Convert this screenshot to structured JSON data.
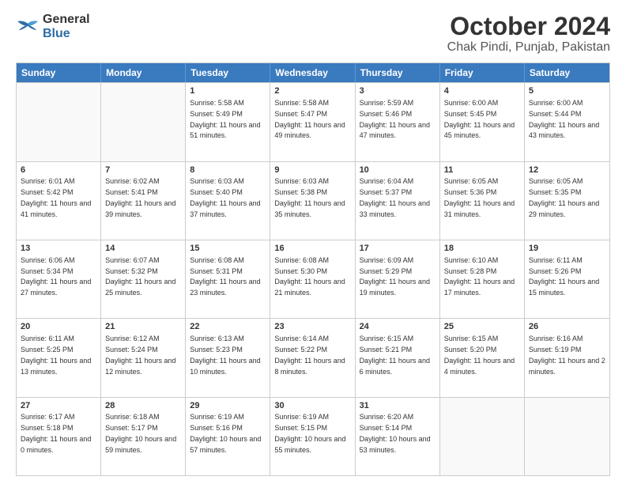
{
  "header": {
    "logo_general": "General",
    "logo_blue": "Blue",
    "title": "October 2024",
    "subtitle": "Chak Pindi, Punjab, Pakistan"
  },
  "calendar": {
    "days": [
      "Sunday",
      "Monday",
      "Tuesday",
      "Wednesday",
      "Thursday",
      "Friday",
      "Saturday"
    ],
    "rows": [
      [
        {
          "day": "",
          "content": ""
        },
        {
          "day": "",
          "content": ""
        },
        {
          "day": "1",
          "content": "Sunrise: 5:58 AM\nSunset: 5:49 PM\nDaylight: 11 hours and 51 minutes."
        },
        {
          "day": "2",
          "content": "Sunrise: 5:58 AM\nSunset: 5:47 PM\nDaylight: 11 hours and 49 minutes."
        },
        {
          "day": "3",
          "content": "Sunrise: 5:59 AM\nSunset: 5:46 PM\nDaylight: 11 hours and 47 minutes."
        },
        {
          "day": "4",
          "content": "Sunrise: 6:00 AM\nSunset: 5:45 PM\nDaylight: 11 hours and 45 minutes."
        },
        {
          "day": "5",
          "content": "Sunrise: 6:00 AM\nSunset: 5:44 PM\nDaylight: 11 hours and 43 minutes."
        }
      ],
      [
        {
          "day": "6",
          "content": "Sunrise: 6:01 AM\nSunset: 5:42 PM\nDaylight: 11 hours and 41 minutes."
        },
        {
          "day": "7",
          "content": "Sunrise: 6:02 AM\nSunset: 5:41 PM\nDaylight: 11 hours and 39 minutes."
        },
        {
          "day": "8",
          "content": "Sunrise: 6:03 AM\nSunset: 5:40 PM\nDaylight: 11 hours and 37 minutes."
        },
        {
          "day": "9",
          "content": "Sunrise: 6:03 AM\nSunset: 5:38 PM\nDaylight: 11 hours and 35 minutes."
        },
        {
          "day": "10",
          "content": "Sunrise: 6:04 AM\nSunset: 5:37 PM\nDaylight: 11 hours and 33 minutes."
        },
        {
          "day": "11",
          "content": "Sunrise: 6:05 AM\nSunset: 5:36 PM\nDaylight: 11 hours and 31 minutes."
        },
        {
          "day": "12",
          "content": "Sunrise: 6:05 AM\nSunset: 5:35 PM\nDaylight: 11 hours and 29 minutes."
        }
      ],
      [
        {
          "day": "13",
          "content": "Sunrise: 6:06 AM\nSunset: 5:34 PM\nDaylight: 11 hours and 27 minutes."
        },
        {
          "day": "14",
          "content": "Sunrise: 6:07 AM\nSunset: 5:32 PM\nDaylight: 11 hours and 25 minutes."
        },
        {
          "day": "15",
          "content": "Sunrise: 6:08 AM\nSunset: 5:31 PM\nDaylight: 11 hours and 23 minutes."
        },
        {
          "day": "16",
          "content": "Sunrise: 6:08 AM\nSunset: 5:30 PM\nDaylight: 11 hours and 21 minutes."
        },
        {
          "day": "17",
          "content": "Sunrise: 6:09 AM\nSunset: 5:29 PM\nDaylight: 11 hours and 19 minutes."
        },
        {
          "day": "18",
          "content": "Sunrise: 6:10 AM\nSunset: 5:28 PM\nDaylight: 11 hours and 17 minutes."
        },
        {
          "day": "19",
          "content": "Sunrise: 6:11 AM\nSunset: 5:26 PM\nDaylight: 11 hours and 15 minutes."
        }
      ],
      [
        {
          "day": "20",
          "content": "Sunrise: 6:11 AM\nSunset: 5:25 PM\nDaylight: 11 hours and 13 minutes."
        },
        {
          "day": "21",
          "content": "Sunrise: 6:12 AM\nSunset: 5:24 PM\nDaylight: 11 hours and 12 minutes."
        },
        {
          "day": "22",
          "content": "Sunrise: 6:13 AM\nSunset: 5:23 PM\nDaylight: 11 hours and 10 minutes."
        },
        {
          "day": "23",
          "content": "Sunrise: 6:14 AM\nSunset: 5:22 PM\nDaylight: 11 hours and 8 minutes."
        },
        {
          "day": "24",
          "content": "Sunrise: 6:15 AM\nSunset: 5:21 PM\nDaylight: 11 hours and 6 minutes."
        },
        {
          "day": "25",
          "content": "Sunrise: 6:15 AM\nSunset: 5:20 PM\nDaylight: 11 hours and 4 minutes."
        },
        {
          "day": "26",
          "content": "Sunrise: 6:16 AM\nSunset: 5:19 PM\nDaylight: 11 hours and 2 minutes."
        }
      ],
      [
        {
          "day": "27",
          "content": "Sunrise: 6:17 AM\nSunset: 5:18 PM\nDaylight: 11 hours and 0 minutes."
        },
        {
          "day": "28",
          "content": "Sunrise: 6:18 AM\nSunset: 5:17 PM\nDaylight: 10 hours and 59 minutes."
        },
        {
          "day": "29",
          "content": "Sunrise: 6:19 AM\nSunset: 5:16 PM\nDaylight: 10 hours and 57 minutes."
        },
        {
          "day": "30",
          "content": "Sunrise: 6:19 AM\nSunset: 5:15 PM\nDaylight: 10 hours and 55 minutes."
        },
        {
          "day": "31",
          "content": "Sunrise: 6:20 AM\nSunset: 5:14 PM\nDaylight: 10 hours and 53 minutes."
        },
        {
          "day": "",
          "content": ""
        },
        {
          "day": "",
          "content": ""
        }
      ]
    ]
  }
}
